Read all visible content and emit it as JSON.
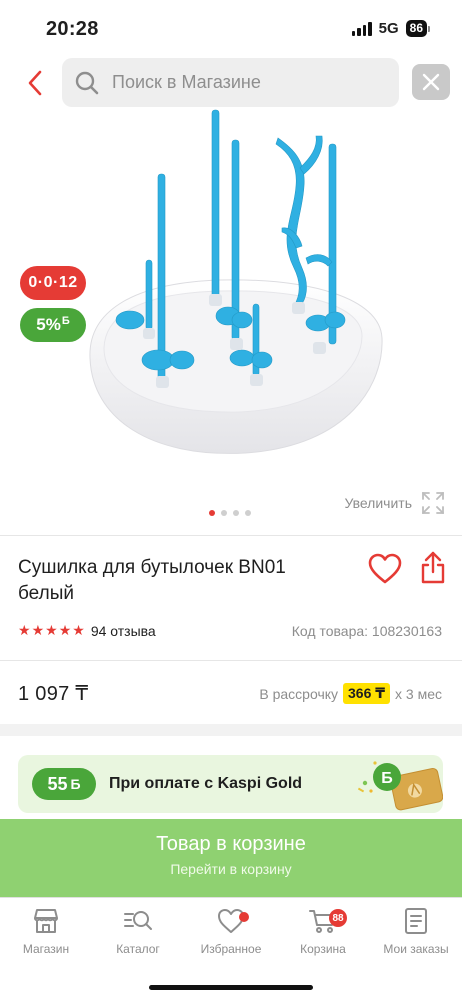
{
  "status_bar": {
    "time": "20:28",
    "network": "5G",
    "battery": "86"
  },
  "search": {
    "placeholder": "Поиск в Магазине"
  },
  "gallery": {
    "badge_installment": "0·0·12",
    "badge_bonus_value": "5%",
    "badge_bonus_currency": "Б",
    "zoom_label": "Увеличить",
    "dots_count": 4,
    "active_dot": 0
  },
  "product": {
    "title": "Сушилка для бутылочек BN01 белый",
    "rating_stars": 5,
    "reviews": "94 отзыва",
    "code": "Код товара: 108230163",
    "price": "1 097 ₸",
    "installment_prefix": "В рассрочку",
    "installment_amount": "366 ₸",
    "installment_suffix": "х 3 мес"
  },
  "kaspi_gold": {
    "bonus": "55",
    "bonus_currency": "Б",
    "text": "При оплате с Kaspi Gold"
  },
  "cart_bar": {
    "title": "Товар в корзине",
    "subtitle": "Перейти в корзину"
  },
  "tabbar": {
    "tabs": [
      {
        "label": "Магазин",
        "icon": "store-icon"
      },
      {
        "label": "Каталог",
        "icon": "catalog-search-icon"
      },
      {
        "label": "Избранное",
        "icon": "heart-icon"
      },
      {
        "label": "Корзина",
        "icon": "cart-icon",
        "badge": "88"
      },
      {
        "label": "Мои заказы",
        "icon": "orders-icon"
      }
    ]
  },
  "colors": {
    "accent_red": "#e53b35",
    "bonus_green": "#4aa63a",
    "cart_green": "#8fd171",
    "installment_yellow": "#ffe100",
    "product_blue": "#2fb0e2"
  }
}
